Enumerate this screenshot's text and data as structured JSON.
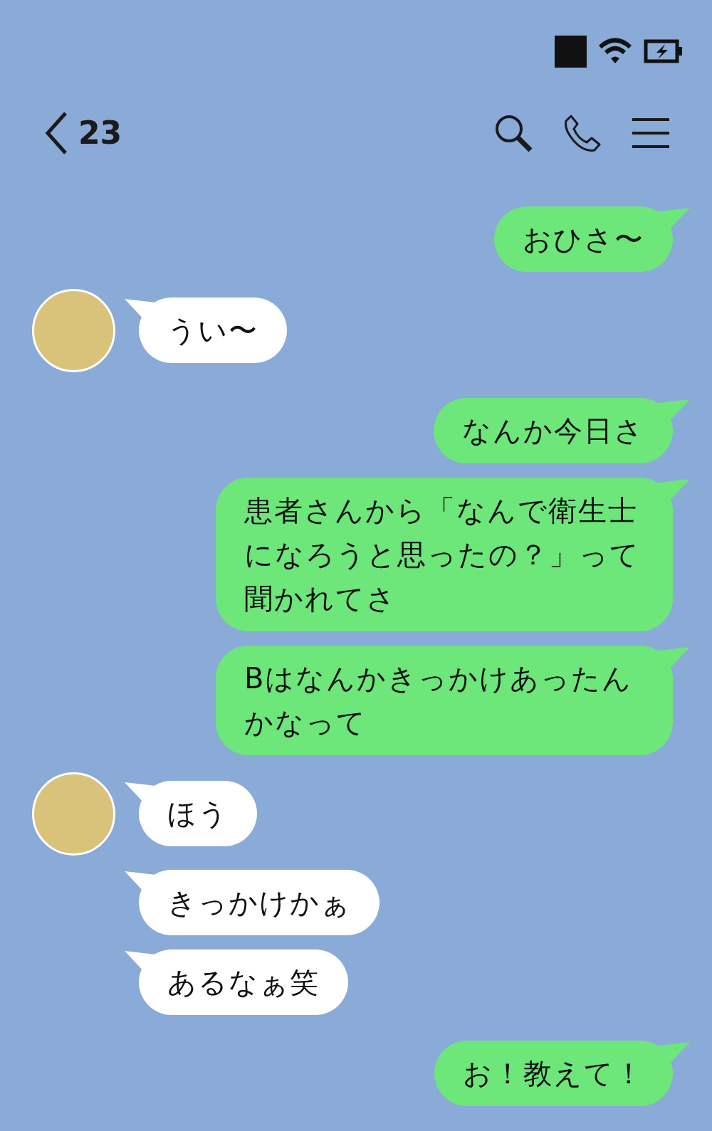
{
  "header": {
    "back_count": "23"
  },
  "messages": [
    {
      "kind": "sent",
      "text": "おひさ〜"
    },
    {
      "kind": "received",
      "avatar": true,
      "text": "うい〜"
    },
    {
      "kind": "sent",
      "text": "なんか今日さ"
    },
    {
      "kind": "sent",
      "text": "患者さんから「なんで衛生士になろうと思ったの？」って聞かれてさ"
    },
    {
      "kind": "sent",
      "text": "Bはなんかきっかけあったんかなって"
    },
    {
      "kind": "received",
      "avatar": true,
      "text": "ほう"
    },
    {
      "kind": "received",
      "avatar": false,
      "text": "きっかけかぁ"
    },
    {
      "kind": "received",
      "avatar": false,
      "text": "あるなぁ笑"
    },
    {
      "kind": "sent",
      "text": "お！教えて！"
    }
  ]
}
